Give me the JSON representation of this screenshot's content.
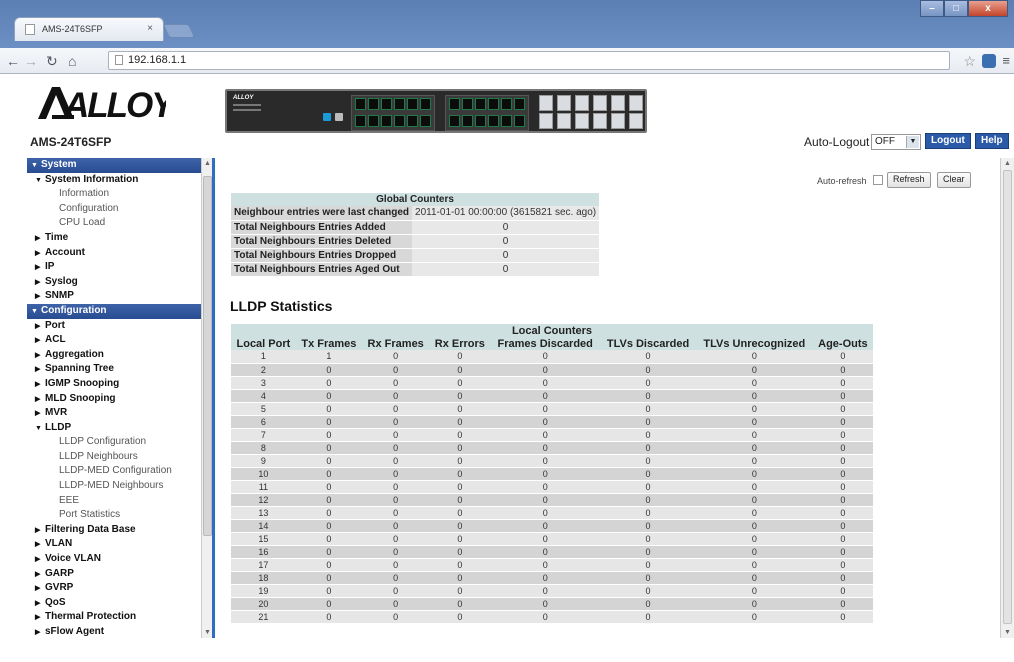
{
  "browser": {
    "tab_title": "AMS-24T6SFP",
    "tab_close": "×",
    "url": "192.168.1.1",
    "win_controls": [
      "–",
      "□",
      "x"
    ]
  },
  "header": {
    "logo_text": "ALLOY",
    "device_name": "AMS-24T6SFP",
    "auto_logout_label": "Auto-Logout",
    "auto_logout_value": "OFF",
    "logout_label": "Logout",
    "help_label": "Help",
    "switch_brand": "ALLOY"
  },
  "menu": [
    {
      "type": "group",
      "label": "System",
      "open": true
    },
    {
      "type": "l1",
      "label": "System Information",
      "open": true
    },
    {
      "type": "l2",
      "label": "Information"
    },
    {
      "type": "l2",
      "label": "Configuration"
    },
    {
      "type": "l2",
      "label": "CPU Load"
    },
    {
      "type": "l1",
      "label": "Time"
    },
    {
      "type": "l1",
      "label": "Account"
    },
    {
      "type": "l1",
      "label": "IP"
    },
    {
      "type": "l1",
      "label": "Syslog"
    },
    {
      "type": "l1",
      "label": "SNMP"
    },
    {
      "type": "group",
      "label": "Configuration",
      "open": true
    },
    {
      "type": "l1",
      "label": "Port"
    },
    {
      "type": "l1",
      "label": "ACL"
    },
    {
      "type": "l1",
      "label": "Aggregation"
    },
    {
      "type": "l1",
      "label": "Spanning Tree"
    },
    {
      "type": "l1",
      "label": "IGMP Snooping"
    },
    {
      "type": "l1",
      "label": "MLD Snooping"
    },
    {
      "type": "l1",
      "label": "MVR"
    },
    {
      "type": "l1",
      "label": "LLDP",
      "open": true
    },
    {
      "type": "l2",
      "label": "LLDP Configuration"
    },
    {
      "type": "l2",
      "label": "LLDP Neighbours"
    },
    {
      "type": "l2",
      "label": "LLDP-MED Configuration"
    },
    {
      "type": "l2",
      "label": "LLDP-MED Neighbours"
    },
    {
      "type": "l2",
      "label": "EEE"
    },
    {
      "type": "l2",
      "label": "Port Statistics"
    },
    {
      "type": "l1",
      "label": "Filtering Data Base"
    },
    {
      "type": "l1",
      "label": "VLAN"
    },
    {
      "type": "l1",
      "label": "Voice VLAN"
    },
    {
      "type": "l1",
      "label": "GARP"
    },
    {
      "type": "l1",
      "label": "GVRP"
    },
    {
      "type": "l1",
      "label": "QoS"
    },
    {
      "type": "l1",
      "label": "Thermal Protection"
    },
    {
      "type": "l1",
      "label": "sFlow Agent"
    }
  ],
  "controls": {
    "auto_refresh_label": "Auto-refresh",
    "refresh_label": "Refresh",
    "clear_label": "Clear"
  },
  "global_counters": {
    "title": "Global Counters",
    "rows": [
      {
        "label": "Neighbour entries were last changed",
        "value": "2011-01-01 00:00:00 (3615821 sec. ago)"
      },
      {
        "label": "Total Neighbours Entries Added",
        "value": "0"
      },
      {
        "label": "Total Neighbours Entries Deleted",
        "value": "0"
      },
      {
        "label": "Total Neighbours Entries Dropped",
        "value": "0"
      },
      {
        "label": "Total Neighbours Entries Aged Out",
        "value": "0"
      }
    ]
  },
  "lldp_stats": {
    "title": "LLDP Statistics",
    "group_header": "Local Counters",
    "columns": [
      "Local Port",
      "Tx Frames",
      "Rx Frames",
      "Rx Errors",
      "Frames Discarded",
      "TLVs Discarded",
      "TLVs Unrecognized",
      "Age-Outs"
    ],
    "rows": [
      [
        "1",
        "1",
        "0",
        "0",
        "0",
        "0",
        "0",
        "0"
      ],
      [
        "2",
        "0",
        "0",
        "0",
        "0",
        "0",
        "0",
        "0"
      ],
      [
        "3",
        "0",
        "0",
        "0",
        "0",
        "0",
        "0",
        "0"
      ],
      [
        "4",
        "0",
        "0",
        "0",
        "0",
        "0",
        "0",
        "0"
      ],
      [
        "5",
        "0",
        "0",
        "0",
        "0",
        "0",
        "0",
        "0"
      ],
      [
        "6",
        "0",
        "0",
        "0",
        "0",
        "0",
        "0",
        "0"
      ],
      [
        "7",
        "0",
        "0",
        "0",
        "0",
        "0",
        "0",
        "0"
      ],
      [
        "8",
        "0",
        "0",
        "0",
        "0",
        "0",
        "0",
        "0"
      ],
      [
        "9",
        "0",
        "0",
        "0",
        "0",
        "0",
        "0",
        "0"
      ],
      [
        "10",
        "0",
        "0",
        "0",
        "0",
        "0",
        "0",
        "0"
      ],
      [
        "11",
        "0",
        "0",
        "0",
        "0",
        "0",
        "0",
        "0"
      ],
      [
        "12",
        "0",
        "0",
        "0",
        "0",
        "0",
        "0",
        "0"
      ],
      [
        "13",
        "0",
        "0",
        "0",
        "0",
        "0",
        "0",
        "0"
      ],
      [
        "14",
        "0",
        "0",
        "0",
        "0",
        "0",
        "0",
        "0"
      ],
      [
        "15",
        "0",
        "0",
        "0",
        "0",
        "0",
        "0",
        "0"
      ],
      [
        "16",
        "0",
        "0",
        "0",
        "0",
        "0",
        "0",
        "0"
      ],
      [
        "17",
        "0",
        "0",
        "0",
        "0",
        "0",
        "0",
        "0"
      ],
      [
        "18",
        "0",
        "0",
        "0",
        "0",
        "0",
        "0",
        "0"
      ],
      [
        "19",
        "0",
        "0",
        "0",
        "0",
        "0",
        "0",
        "0"
      ],
      [
        "20",
        "0",
        "0",
        "0",
        "0",
        "0",
        "0",
        "0"
      ],
      [
        "21",
        "0",
        "0",
        "0",
        "0",
        "0",
        "0",
        "0"
      ]
    ]
  },
  "colors": {
    "menu_group": "#274c92",
    "table_header": "#cfe0e0",
    "button_blue": "#2a5aa8"
  }
}
